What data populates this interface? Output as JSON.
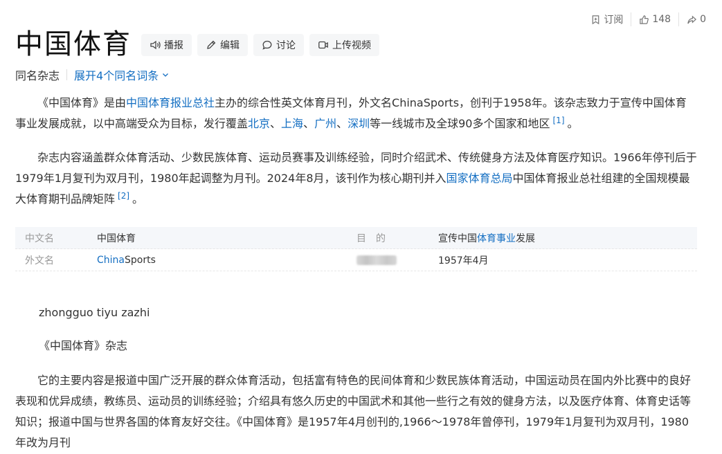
{
  "top_actions": {
    "subscribe": "订阅",
    "likes": "148",
    "shares": "0"
  },
  "header": {
    "title": "中国体育",
    "buttons": {
      "play": "播报",
      "edit": "编辑",
      "discuss": "讨论",
      "upload": "上传视频"
    }
  },
  "subtitle": {
    "same_name": "同名杂志",
    "expand": "展开4个同名词条"
  },
  "para1": {
    "t1": "《中国体育》是由",
    "l1": "中国体育报业总社",
    "t2": "主办的综合性英文体育月刊，外文名ChinaSports，创刊于1958年。该杂志致力于宣传中国体育事业发展成就，以中高端受众为目标，发行覆盖",
    "l2": "北京",
    "s1": "、",
    "l3": "上海",
    "s2": "、",
    "l4": "广州",
    "s3": "、",
    "l5": "深圳",
    "t3": "等一线城市及全球90多个国家和地区",
    "ref": "[1]",
    "end": "。"
  },
  "para2": {
    "t1": "杂志内容涵盖群众体育活动、少数民族体育、运动员赛事及训练经验，同时介绍武术、传统健身方法及体育医疗知识。1966年停刊后于1979年1月复刊为双月刊，1980年起调整为月刊。2024年8月，该刊作为核心期刊并入",
    "l1": "国家体育总局",
    "t2": "中国体育报业总社组建的全国规模最大体育期刊品牌矩阵",
    "ref": "[2]",
    "end": "。"
  },
  "info": {
    "row1": {
      "k1": "中文名",
      "v1": "中国体育",
      "k2": "目　的",
      "v2_pre": "宣传中国",
      "v2_link": "体育事业",
      "v2_post": "发展"
    },
    "row2": {
      "k1": "外文名",
      "v1_link": "China",
      "v1_post": "Sports",
      "v2": "1957年4月"
    }
  },
  "pinyin": "zhongguo tiyu zazhi",
  "magazine_name": "《中国体育》杂志",
  "para3": "它的主要内容是报道中国广泛开展的群众体育活动，包括富有特色的民间体育和少数民族体育活动，中国运动员在国内外比赛中的良好表现和优异成绩，教练员、运动员的训练经验；介绍具有悠久历史的中国武术和其他一些行之有效的健身方法，以及医疗体育、体育史话等知识；报道中国与世界各国的体育友好交往。《中国体育》是1957年4月创刊的,1966～1978年曾停刊，1979年1月复刊为双月刊，1980年改为月刊",
  "colors": {
    "link": "#136ec2",
    "text": "#333333",
    "muted": "#999999"
  }
}
